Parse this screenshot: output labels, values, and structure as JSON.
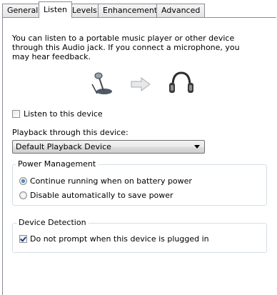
{
  "tabs": [
    {
      "label": "General",
      "active": false
    },
    {
      "label": "Listen",
      "active": true
    },
    {
      "label": "Levels",
      "active": false
    },
    {
      "label": "Enhancements",
      "active": false
    },
    {
      "label": "Advanced",
      "active": false
    }
  ],
  "description": "You can listen to a portable music player or other device through this Audio jack.  If you connect a microphone, you may hear feedback.",
  "icons": {
    "source": "microphone-icon",
    "arrow": "right-arrow-icon",
    "output": "headphones-icon"
  },
  "listen_checkbox": {
    "label": "Listen to this device",
    "checked": false
  },
  "playback": {
    "label": "Playback through this device:",
    "selected": "Default Playback Device"
  },
  "power_management": {
    "title": "Power Management",
    "options": [
      {
        "label": "Continue running when on battery power",
        "selected": true
      },
      {
        "label": "Disable automatically to save power",
        "selected": false
      }
    ]
  },
  "device_detection": {
    "title": "Device Detection",
    "checkbox": {
      "label": "Do not prompt when this device is plugged in",
      "checked": true
    }
  },
  "colors": {
    "border": "#898c95",
    "accent": "#1b4e9e"
  }
}
